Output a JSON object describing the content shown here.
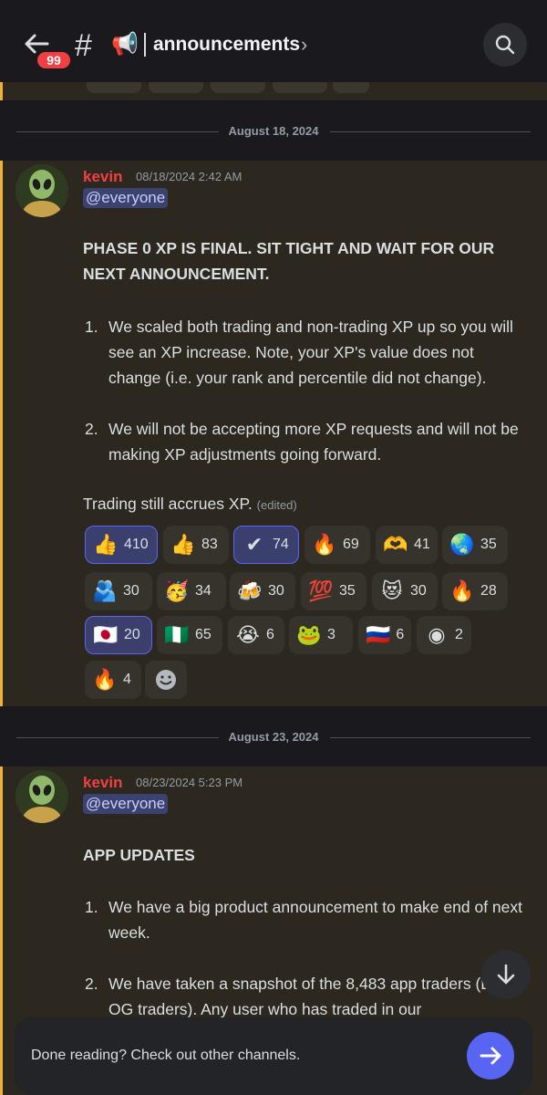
{
  "header": {
    "badge": "99",
    "channel_name": "announcements"
  },
  "dividers": [
    "August 18, 2024",
    "August 23, 2024"
  ],
  "messages": [
    {
      "author": "kevin",
      "timestamp": "08/18/2024 2:42 AM",
      "mention": "@everyone",
      "heading": "PHASE 0 XP IS FINAL. SIT TIGHT AND WAIT FOR OUR NEXT ANNOUNCEMENT.",
      "items": [
        {
          "num": "1.",
          "text": "We scaled both trading and non-trading XP up so you will see an XP increase. Note, your XP's value does not change (i.e. your rank and percentile did not change)."
        },
        {
          "num": "2.",
          "text": "We will not be accepting more XP requests and will not be making XP adjustments going forward."
        }
      ],
      "footer": "Trading still accrues XP.",
      "edited": "(edited)",
      "reactions": [
        {
          "emoji": "👍",
          "icon": "thumbs-up",
          "count": "410",
          "me": true
        },
        {
          "emoji": "👍",
          "icon": "thumbs-up-dark",
          "count": "83",
          "me": false
        },
        {
          "emoji": "✔",
          "icon": "verified-badge",
          "count": "74",
          "me": true
        },
        {
          "emoji": "🔥",
          "icon": "fire-flame",
          "count": "69",
          "me": false
        },
        {
          "emoji": "🫶",
          "icon": "heart-hands",
          "count": "41",
          "me": false
        },
        {
          "emoji": "🌏",
          "icon": "globe",
          "count": "35",
          "me": false
        },
        {
          "emoji": "🫂",
          "icon": "people-hugging",
          "count": "30",
          "me": false
        },
        {
          "emoji": "🥳",
          "icon": "partying-face",
          "count": "34",
          "me": false
        },
        {
          "emoji": "🍻",
          "icon": "beers",
          "count": "30",
          "me": false
        },
        {
          "emoji": "💯",
          "icon": "hundred",
          "count": "35",
          "me": false
        },
        {
          "emoji": "😻",
          "icon": "heart-eyes-cat",
          "count": "30",
          "me": false
        },
        {
          "emoji": "🔥",
          "icon": "fire",
          "count": "28",
          "me": false
        },
        {
          "emoji": "🇯🇵",
          "icon": "flag-japan",
          "count": "20",
          "me": true
        },
        {
          "emoji": "🇳🇬",
          "icon": "flag-nigeria",
          "count": "65",
          "me": false
        },
        {
          "emoji": "😭",
          "icon": "crying-face",
          "count": "6",
          "me": false
        },
        {
          "emoji": "🐸",
          "icon": "scam-pepe",
          "count": "3",
          "me": false
        },
        {
          "emoji": "🇷🇺",
          "icon": "flag-russia",
          "count": "6",
          "me": false
        },
        {
          "emoji": "◉",
          "icon": "dflow-logo",
          "count": "2",
          "me": false
        },
        {
          "emoji": "🔥",
          "icon": "fire-flame",
          "count": "4",
          "me": false
        }
      ]
    },
    {
      "author": "kevin",
      "timestamp": "08/23/2024 5:23 PM",
      "mention": "@everyone",
      "heading": "APP UPDATES",
      "items": [
        {
          "num": "1.",
          "text": "We have a big product announcement to make end of next week."
        },
        {
          "num": "2.",
          "text": "We have taken a snapshot of the 8,483 app traders (DFlow OG traders). Any user who has traded in our"
        }
      ]
    }
  ],
  "bottom_bar": {
    "text": "Done reading? Check out other channels."
  },
  "colors": {
    "accent": "#5865f2",
    "author": "#f23f43",
    "highlight_border": "#f0b232",
    "highlight_bg": "#2c2820"
  }
}
